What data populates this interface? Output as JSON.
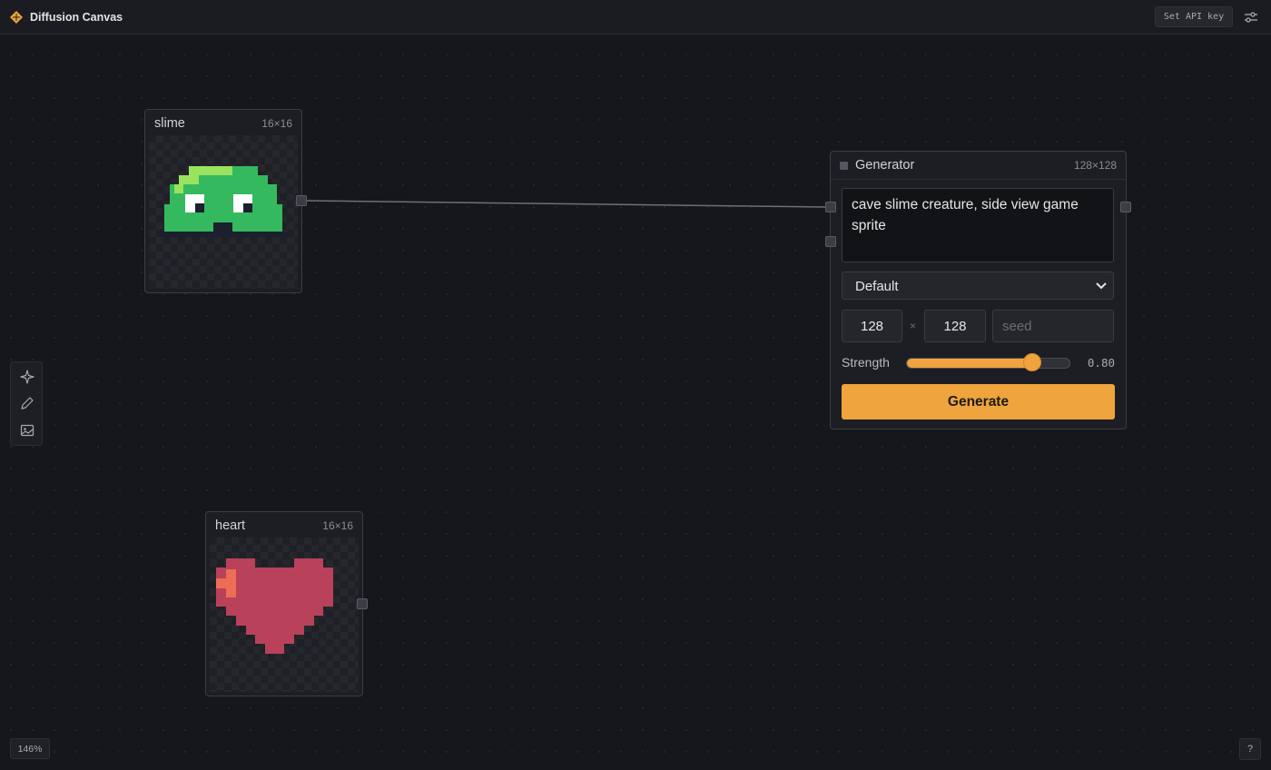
{
  "app": {
    "title": "Diffusion Canvas",
    "api_key_label": "Set API key"
  },
  "colors": {
    "accent": "#efa43d",
    "background": "#16171b",
    "slime": "#35b95f",
    "heart": "#b9415a"
  },
  "nodes": {
    "slime": {
      "title": "slime",
      "size": "16×16"
    },
    "heart": {
      "title": "heart",
      "size": "16×16"
    },
    "generator": {
      "title": "Generator",
      "size": "128×128",
      "prompt": "cave slime creature, side view game sprite",
      "model": "Default",
      "width": "128",
      "times": "×",
      "height": "128",
      "seed_placeholder": "seed",
      "strength_label": "Strength",
      "strength": 0.8,
      "strength_display": "0.80",
      "generate_label": "Generate"
    }
  },
  "tools": [
    "sparkle-icon",
    "pencil-icon",
    "image-icon"
  ],
  "zoom": "146%",
  "help_label": "?"
}
